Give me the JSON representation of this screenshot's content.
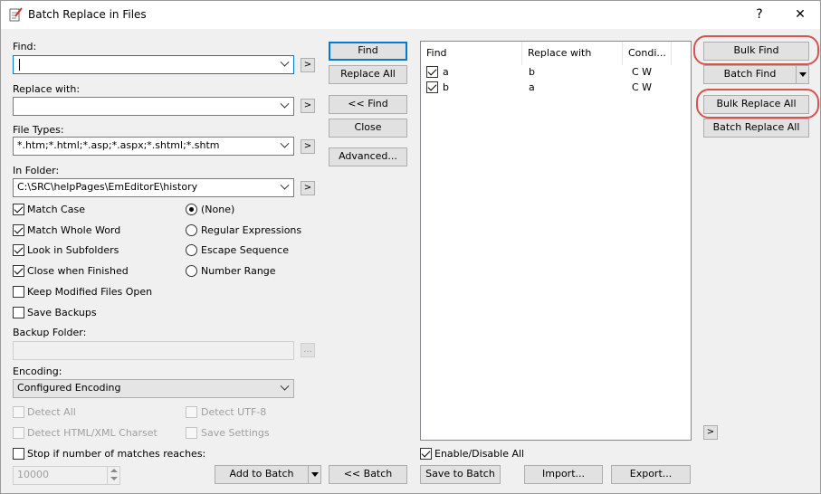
{
  "window": {
    "title": "Batch Replace in Files",
    "help_glyph": "?",
    "close_glyph": "✕"
  },
  "find": {
    "label": "Find:",
    "value": ""
  },
  "replace": {
    "label": "Replace with:",
    "value": ""
  },
  "file_types": {
    "label": "File Types:",
    "value": "*.htm;*.html;*.asp;*.aspx;*.shtml;*.shtm"
  },
  "in_folder": {
    "label": "In Folder:",
    "value": "C:\\SRC\\helpPages\\EmEditorE\\history"
  },
  "more_glyph": ">",
  "browse_glyph": "...",
  "options": {
    "match_case": {
      "label": "Match Case",
      "checked": true
    },
    "match_whole_word": {
      "label": "Match Whole Word",
      "checked": true
    },
    "look_in_subfolders": {
      "label": "Look in Subfolders",
      "checked": true
    },
    "close_when_finished": {
      "label": "Close when Finished",
      "checked": true
    },
    "keep_modified_open": {
      "label": "Keep Modified Files Open",
      "checked": false
    },
    "save_backups": {
      "label": "Save Backups",
      "checked": false
    }
  },
  "modes": {
    "none": "(None)",
    "regex": "Regular Expressions",
    "escape": "Escape Sequence",
    "number_range": "Number Range",
    "selected": "none"
  },
  "backup_folder": {
    "label": "Backup Folder:",
    "value": ""
  },
  "encoding": {
    "label": "Encoding:",
    "value": "Configured Encoding",
    "detect_all": "Detect All",
    "detect_utf8": "Detect UTF-8",
    "detect_html": "Detect HTML/XML Charset",
    "save_settings": "Save Settings"
  },
  "stop_if": {
    "label": "Stop if number of matches reaches:",
    "value": "10000",
    "checked": false
  },
  "buttons": {
    "find": "Find",
    "replace_all": "Replace All",
    "back_find": "<< Find",
    "close": "Close",
    "advanced": "Advanced...",
    "add_to_batch": "Add to Batch",
    "back_batch": "<< Batch",
    "save_to_batch": "Save to Batch",
    "import": "Import...",
    "export": "Export...",
    "bulk_find": "Bulk Find",
    "batch_find": "Batch Find",
    "bulk_replace_all": "Bulk Replace All",
    "batch_replace_all": "Batch Replace All",
    "expand": ">"
  },
  "batch_list": {
    "columns": [
      "Find",
      "Replace with",
      "Condi..."
    ],
    "rows": [
      {
        "find": "a",
        "replace": "b",
        "cond": "C  W",
        "checked": true
      },
      {
        "find": "b",
        "replace": "a",
        "cond": "C  W",
        "checked": true
      }
    ]
  },
  "enable_disable_all": {
    "label": "Enable/Disable All",
    "checked": true
  },
  "colors": {
    "accent": "#0078d7",
    "highlight": "#d9534f"
  }
}
